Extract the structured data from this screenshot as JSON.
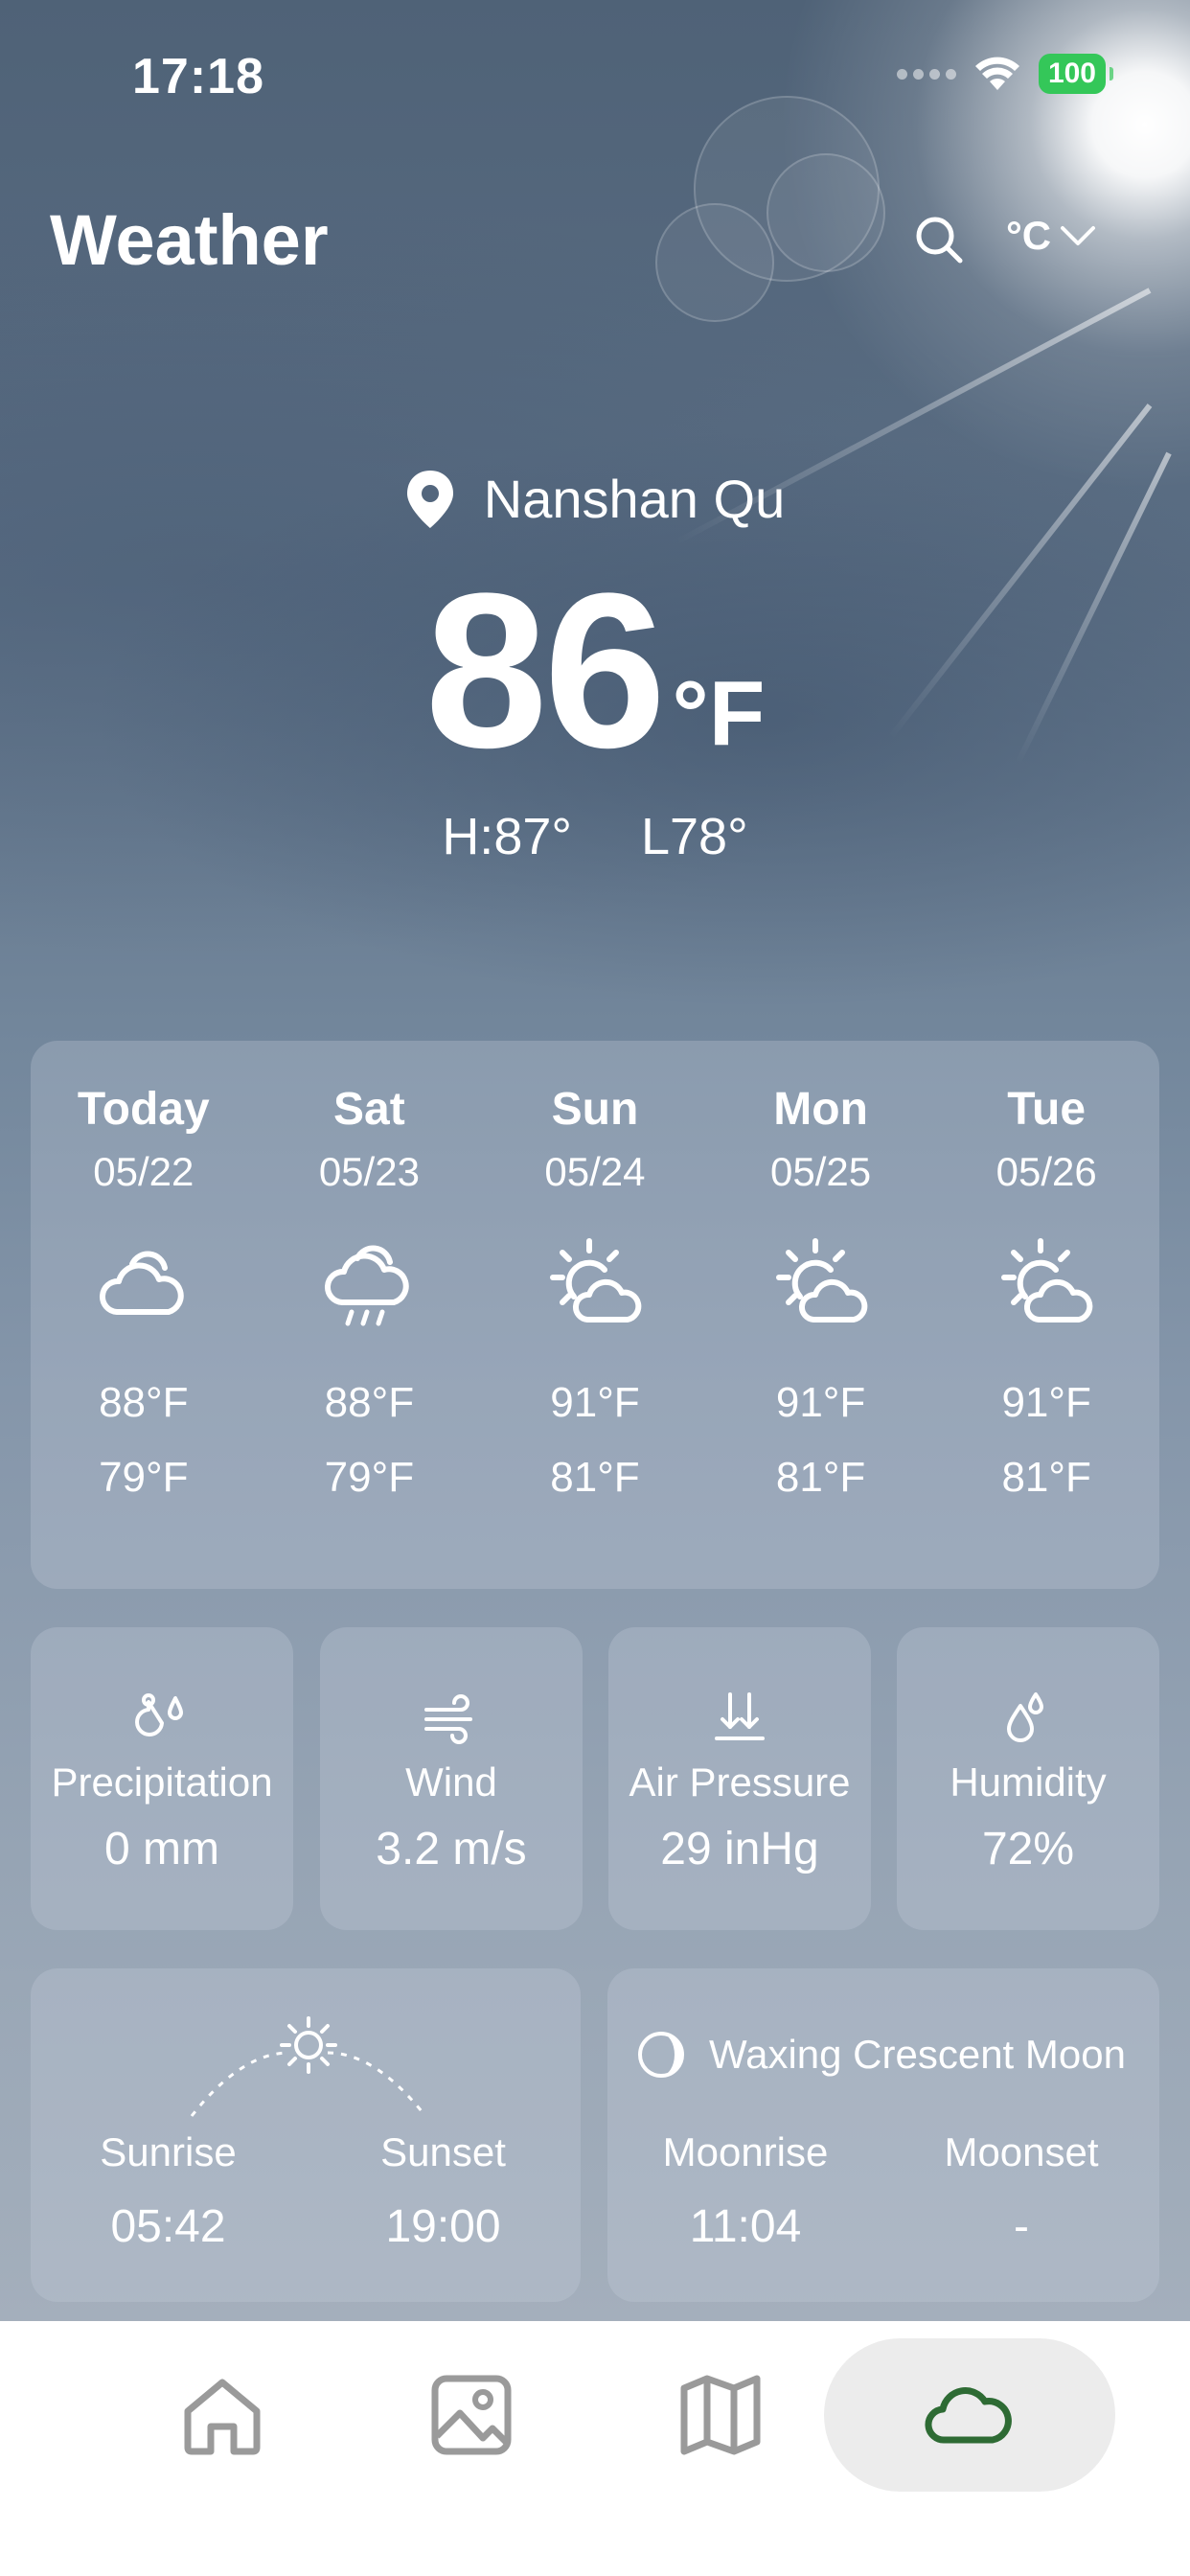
{
  "status_bar": {
    "time": "17:18",
    "battery": "100"
  },
  "header": {
    "title": "Weather",
    "unit_toggle": "°C"
  },
  "current": {
    "location": "Nanshan Qu",
    "temperature": "86",
    "unit": "°F",
    "high": "H:87°",
    "low": "L78°"
  },
  "forecast": [
    {
      "day": "Today",
      "date": "05/22",
      "icon": "cloudy-icon",
      "high": "88°F",
      "low": "79°F"
    },
    {
      "day": "Sat",
      "date": "05/23",
      "icon": "cloud-rain-icon",
      "high": "88°F",
      "low": "79°F"
    },
    {
      "day": "Sun",
      "date": "05/24",
      "icon": "partly-sunny-icon",
      "high": "91°F",
      "low": "81°F"
    },
    {
      "day": "Mon",
      "date": "05/25",
      "icon": "partly-sunny-icon",
      "high": "91°F",
      "low": "81°F"
    },
    {
      "day": "Tue",
      "date": "05/26",
      "icon": "partly-sunny-icon",
      "high": "91°F",
      "low": "81°F"
    }
  ],
  "metrics": [
    {
      "label": "Precipitation",
      "value": "0 mm",
      "icon": "precipitation-icon"
    },
    {
      "label": "Wind",
      "value": "3.2 m/s",
      "icon": "wind-icon"
    },
    {
      "label": "Air Pressure",
      "value": "29 inHg",
      "icon": "air-pressure-icon"
    },
    {
      "label": "Humidity",
      "value": "72%",
      "icon": "humidity-icon"
    }
  ],
  "sun": {
    "sunrise_label": "Sunrise",
    "sunrise": "05:42",
    "sunset_label": "Sunset",
    "sunset": "19:00"
  },
  "moon": {
    "phase": "Waxing Crescent Moon",
    "moonrise_label": "Moonrise",
    "moonrise": "11:04",
    "moonset_label": "Moonset",
    "moonset": "-"
  },
  "tabs": [
    {
      "name": "home",
      "icon": "home-icon",
      "active": false
    },
    {
      "name": "gallery",
      "icon": "image-icon",
      "active": false
    },
    {
      "name": "map",
      "icon": "map-icon",
      "active": false
    },
    {
      "name": "weather",
      "icon": "cloud-icon",
      "active": true
    }
  ],
  "colors": {
    "battery": "#34c759",
    "active_tab_icon": "#2e6b34",
    "tab_icon": "#9a9a9a"
  }
}
